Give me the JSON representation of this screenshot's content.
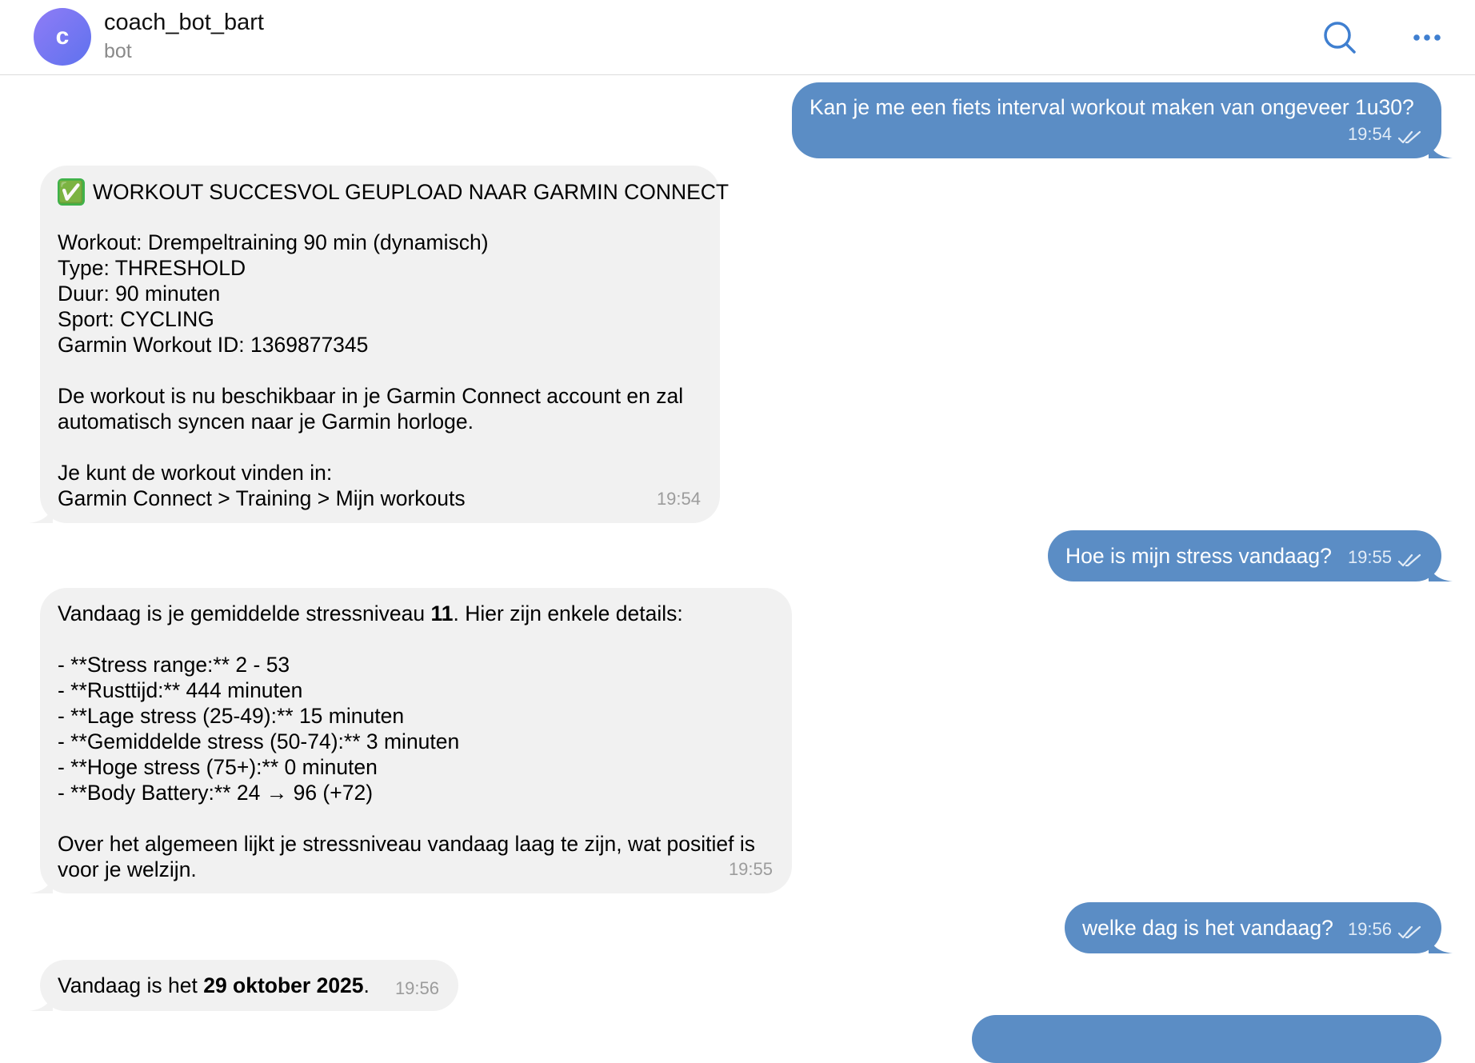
{
  "header": {
    "avatar_letter": "c",
    "title": "coach_bot_bart",
    "subtitle": "bot",
    "search_icon": "search-icon",
    "more_icon": "more-horizontal-icon"
  },
  "colors": {
    "outgoing_bubble": "#5b8dc5",
    "incoming_bubble": "#f1f1f1",
    "accent": "#3f7fd0"
  },
  "messages": [
    {
      "direction": "out",
      "text": "Kan je me een fiets interval workout maken van ongeveer 1u30?",
      "time": "19:54",
      "status": "read"
    },
    {
      "direction": "in",
      "heading_emoji": "✅",
      "heading": "WORKOUT SUCCESVOL GEUPLOAD NAAR GARMIN CONNECT",
      "details": "Workout: Drempeltraining 90 min (dynamisch)\nType: THRESHOLD\nDuur: 90 minuten\nSport: CYCLING\nGarmin Workout ID: 1369877345",
      "body": "De workout is nu beschikbaar in je Garmin Connect account en zal\nautomatisch syncen naar je Garmin horloge.",
      "footer": "Je kunt de workout vinden in:\nGarmin Connect > Training > Mijn workouts",
      "time": "19:54"
    },
    {
      "direction": "out",
      "text": "Hoe is mijn stress vandaag?",
      "time": "19:55",
      "status": "read"
    },
    {
      "direction": "in",
      "intro_pre": "Vandaag is je gemiddelde stressniveau ",
      "intro_bold": "11",
      "intro_post": ". Hier zijn enkele details:",
      "list": "- **Stress range:** 2 - 53\n- **Rusttijd:** 444 minuten\n- **Lage stress (25-49):** 15 minuten\n- **Gemiddelde stress (50-74):** 3 minuten\n- **Hoge stress (75+):** 0 minuten\n- **Body Battery:** 24 → 96 (+72)",
      "outro": "Over het algemeen lijkt je stressniveau vandaag laag te zijn, wat positief is\nvoor je welzijn.",
      "time": "19:55"
    },
    {
      "direction": "out",
      "text": "welke dag is het vandaag?",
      "time": "19:56",
      "status": "read"
    },
    {
      "direction": "in",
      "text_pre": "Vandaag is het ",
      "text_bold": "29 oktober 2025",
      "text_post": ".",
      "time": "19:56"
    }
  ]
}
